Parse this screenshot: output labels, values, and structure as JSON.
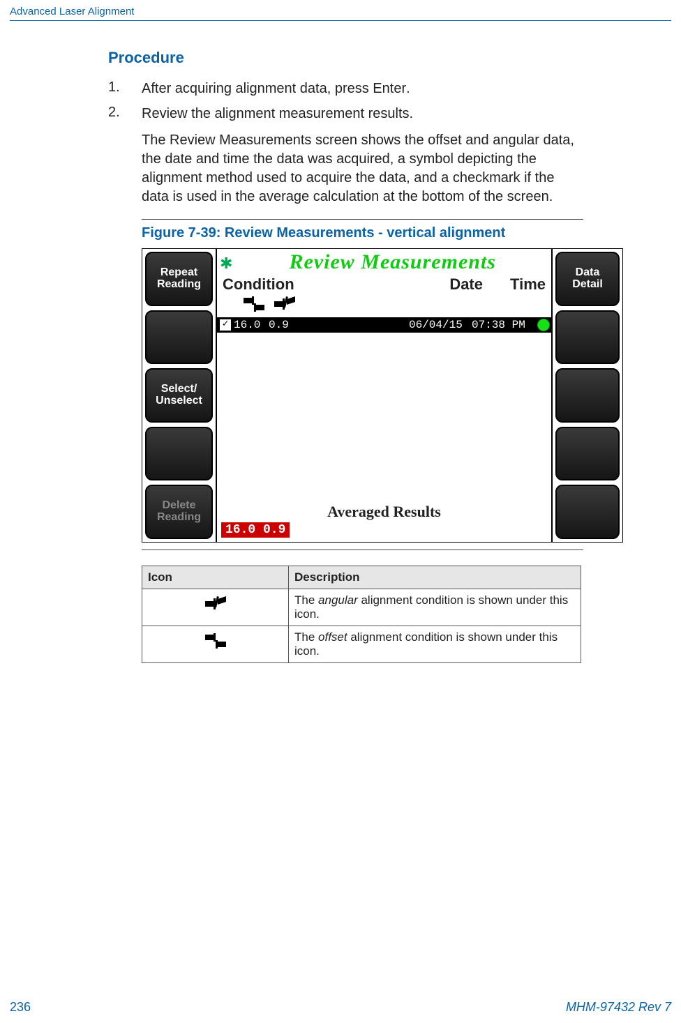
{
  "header": {
    "section": "Advanced Laser Alignment"
  },
  "procedure": {
    "heading": "Procedure",
    "steps": [
      {
        "num": "1.",
        "text_a": "After acquiring alignment data, press ",
        "text_b": "Enter",
        "text_c": "."
      },
      {
        "num": "2.",
        "text_a": "Review the alignment measurement results.",
        "text_b": "",
        "text_c": ""
      }
    ],
    "step2_body": "The Review Measurements screen shows the offset and angular data, the date and time the data was acquired, a symbol depicting the alignment method used to acquire the data, and a checkmark if the data is used in the average calculation at the bottom of the screen."
  },
  "figure": {
    "label": "Figure 7-39:   Review Measurements - vertical alignment",
    "title": "Review Measurements",
    "col_condition": "Condition",
    "col_date": "Date",
    "col_time": "Time",
    "left_buttons": [
      "Repeat\nReading",
      "",
      "Select/\nUnselect",
      "",
      "Delete\nReading"
    ],
    "right_buttons": [
      "Data\nDetail",
      "",
      "",
      "",
      ""
    ],
    "checkmark": "✓",
    "row": {
      "v1": "16.0",
      "v2": "0.9",
      "date": "06/04/15",
      "time": "07:38 PM"
    },
    "avg_title": "Averaged Results",
    "avg_values": "16.0  0.9"
  },
  "table": {
    "h_icon": "Icon",
    "h_desc": "Description",
    "row1_a": "The ",
    "row1_b": "angular",
    "row1_c": " alignment condition is shown under this icon.",
    "row2_a": "The ",
    "row2_b": "offset",
    "row2_c": " alignment condition is shown under this icon."
  },
  "footer": {
    "page": "236",
    "doc": "MHM-97432 Rev 7"
  }
}
